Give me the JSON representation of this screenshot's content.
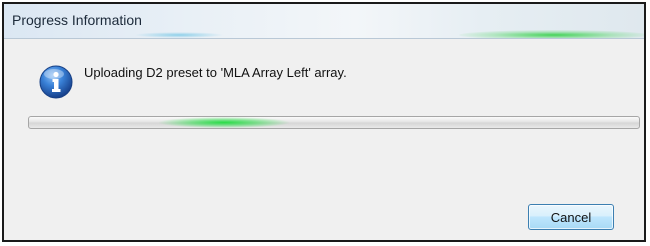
{
  "window": {
    "title": "Progress Information"
  },
  "message": {
    "icon": "info-icon",
    "text": "Uploading D2 preset to 'MLA Array Left' array."
  },
  "progress": {
    "mode": "indeterminate",
    "color": "#28dc46"
  },
  "buttons": {
    "cancel_label": "Cancel"
  },
  "colors": {
    "accent_blue": "#1f5fb8",
    "button_border": "#3c7fb1"
  }
}
